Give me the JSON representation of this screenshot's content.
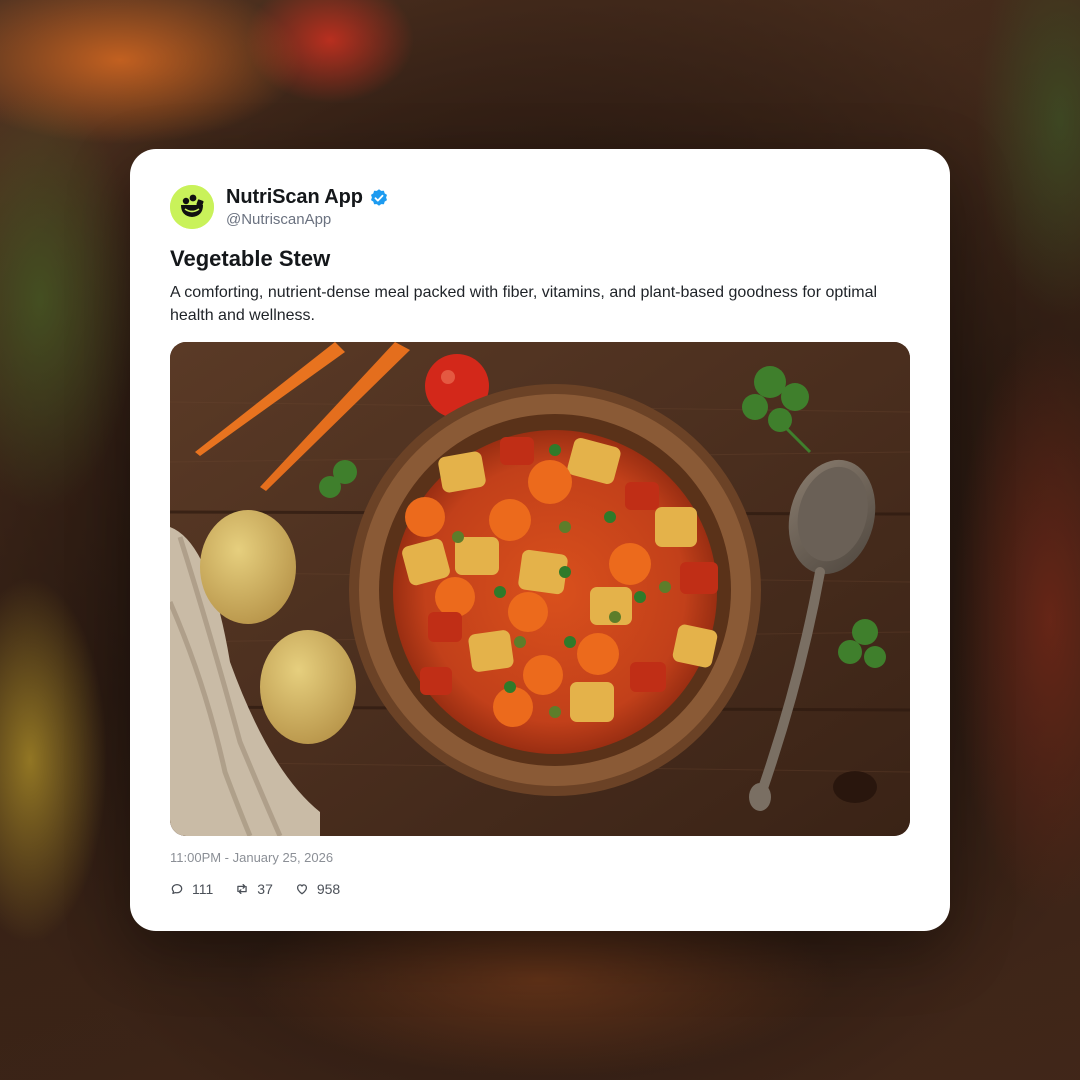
{
  "post": {
    "author": {
      "display_name": "NutriScan App",
      "handle": "@NutriscanApp",
      "verified": true,
      "avatar_icon": "nutriscan-logo-icon",
      "avatar_color": "#c9f25a"
    },
    "title": "Vegetable Stew",
    "description": "A comforting, nutrient-dense meal packed with fiber, vitamins, and plant-based goodness for optimal health and wellness.",
    "image_icon": "vegetable-stew-photo",
    "timestamp": "11:00PM - January 25, 2026",
    "stats": {
      "replies": "111",
      "reposts": "37",
      "likes": "958"
    },
    "icons": {
      "replies": "comment-icon",
      "reposts": "repost-icon",
      "likes": "heart-icon",
      "verified": "verified-badge-icon"
    },
    "colors": {
      "verified": "#1d9bf0",
      "text_primary": "#14171a",
      "text_secondary": "#6b7280"
    }
  }
}
